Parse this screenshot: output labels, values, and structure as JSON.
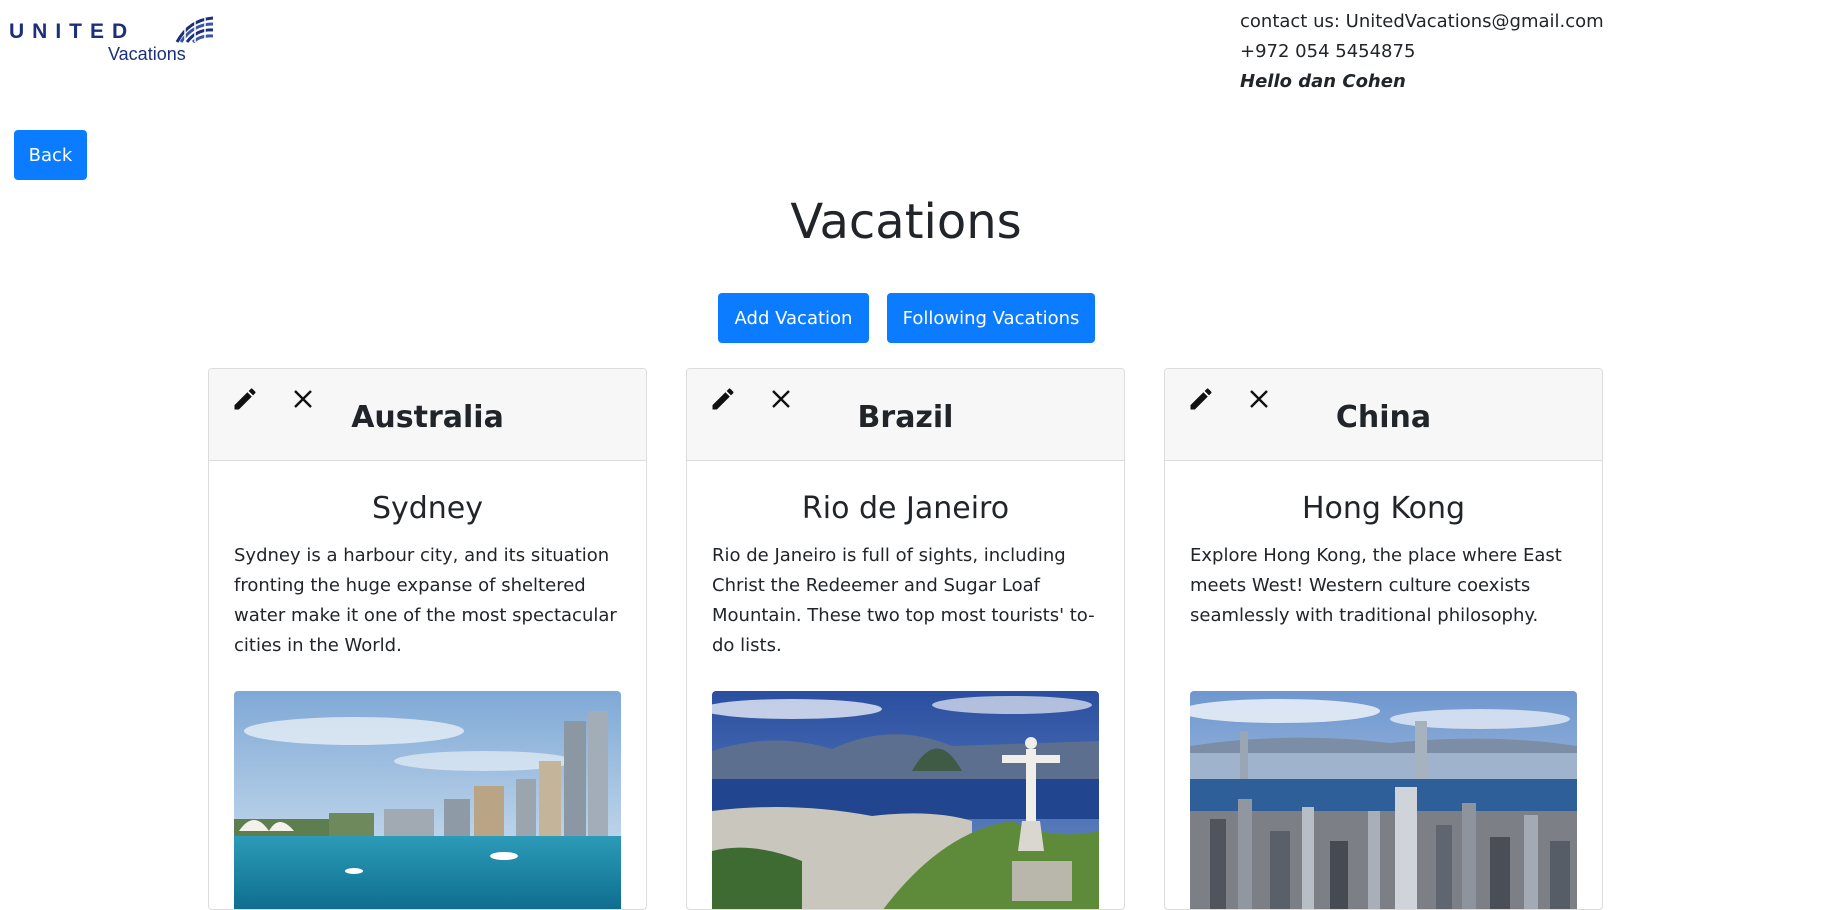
{
  "header": {
    "logo_word": "UNITED",
    "logo_sub": "Vacations",
    "contact_line": "contact us: UnitedVacations@gmail.com",
    "phone_line": "+972 054 5454875",
    "greeting": "Hello dan Cohen"
  },
  "nav": {
    "back_label": "Back"
  },
  "main": {
    "title": "Vacations",
    "add_label": "Add Vacation",
    "following_label": "Following Vacations"
  },
  "cards": [
    {
      "country": "Australia",
      "city": "Sydney",
      "description": "Sydney is a harbour city, and its situation fronting the huge expanse of sheltered water make it one of the most spectacular cities in the World."
    },
    {
      "country": "Brazil",
      "city": "Rio de Janeiro",
      "description": "Rio de Janeiro is full of sights, including Christ the Redeemer and Sugar Loaf Mountain. These two top most tourists' to-do lists."
    },
    {
      "country": "China",
      "city": "Hong Kong",
      "description": "Explore Hong Kong, the place where East meets West! Western culture coexists seamlessly with traditional philosophy."
    }
  ],
  "colors": {
    "primary": "#0b7bff",
    "brand": "#1c2f7a",
    "header_bg": "#f7f7f7"
  },
  "icons": {
    "edit": "pencil-icon",
    "remove": "close-icon"
  }
}
